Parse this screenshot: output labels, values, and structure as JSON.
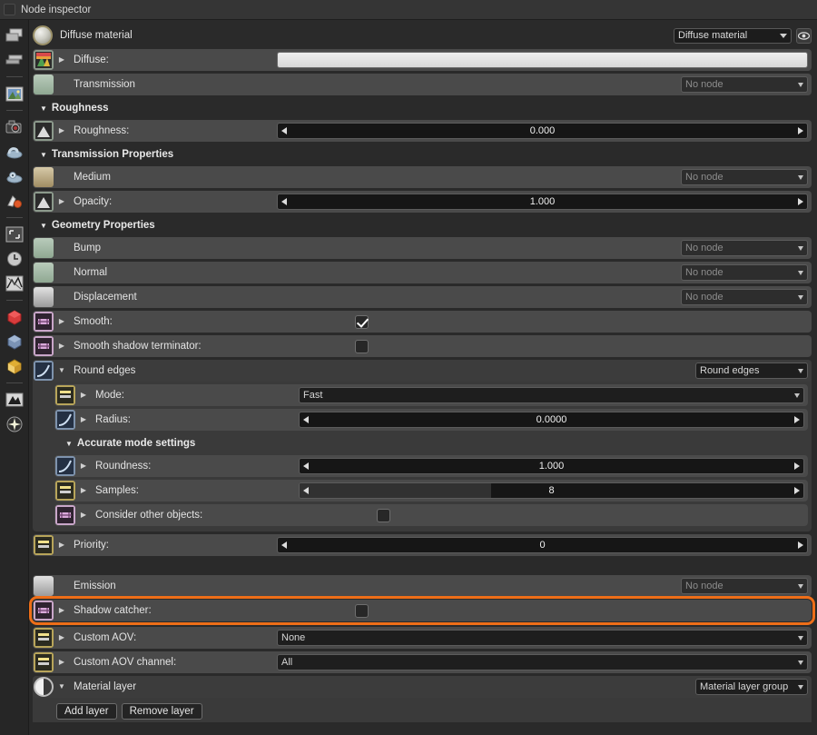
{
  "window": {
    "title": "Node inspector"
  },
  "toolbar": {
    "items": [
      {
        "name": "render-layers-icon",
        "label": "Render layers"
      },
      {
        "name": "layers-stack-icon",
        "label": "Layers"
      },
      {
        "name": "image-icon",
        "label": "Image"
      },
      {
        "name": "camera-icon",
        "label": "Camera"
      },
      {
        "name": "environment-icon",
        "label": "Environment"
      },
      {
        "name": "geometry-icon",
        "label": "Geometry"
      },
      {
        "name": "material-icon",
        "label": "Material"
      },
      {
        "name": "render-region-icon",
        "label": "Render region"
      },
      {
        "name": "clock-icon",
        "label": "Time"
      },
      {
        "name": "noise-icon",
        "label": "Noise"
      },
      {
        "name": "red-cube-icon",
        "label": "Red object"
      },
      {
        "name": "blue-cube-icon",
        "label": "Blue object"
      },
      {
        "name": "yellow-cube-icon",
        "label": "Yellow object"
      },
      {
        "name": "histogram-icon",
        "label": "Imager"
      },
      {
        "name": "star-icon",
        "label": "Kernel"
      }
    ]
  },
  "node_header": {
    "title": "Diffuse material",
    "type_combo": "Diffuse material",
    "eye_icon": "eye-icon"
  },
  "rows": {
    "diffuse": {
      "label": "Diffuse:",
      "value_kind": "color",
      "color": "#e4e4e4"
    },
    "transmission": {
      "label": "Transmission",
      "value": "No node"
    },
    "roughness_section": "Roughness",
    "roughness": {
      "label": "Roughness:",
      "value": "0.000"
    },
    "transmission_section": "Transmission Properties",
    "medium": {
      "label": "Medium",
      "value": "No node"
    },
    "opacity": {
      "label": "Opacity:",
      "value": "1.000"
    },
    "geometry_section": "Geometry Properties",
    "bump": {
      "label": "Bump",
      "value": "No node"
    },
    "normal": {
      "label": "Normal",
      "value": "No node"
    },
    "displacement": {
      "label": "Displacement",
      "value": "No node"
    },
    "smooth": {
      "label": "Smooth:",
      "checked": "true"
    },
    "smooth_shadow": {
      "label": "Smooth shadow terminator:",
      "checked": "false"
    },
    "round_edges": {
      "label": "Round edges",
      "combo": "Round edges"
    },
    "mode": {
      "label": "Mode:",
      "value": "Fast"
    },
    "radius": {
      "label": "Radius:",
      "value": "0.0000"
    },
    "accurate_section": "Accurate mode settings",
    "roundness": {
      "label": "Roundness:",
      "value": "1.000"
    },
    "samples": {
      "label": "Samples:",
      "value": "8",
      "fill_pct": 38
    },
    "consider_other": {
      "label": "Consider other objects:",
      "checked": "false"
    },
    "priority": {
      "label": "Priority:",
      "value": "0"
    },
    "emission": {
      "label": "Emission",
      "value": "No node"
    },
    "shadow_catcher": {
      "label": "Shadow catcher:",
      "checked": "false",
      "highlight": "#ee6e18"
    },
    "custom_aov": {
      "label": "Custom AOV:",
      "value": "None"
    },
    "custom_aov_channel": {
      "label": "Custom AOV channel:",
      "value": "All"
    },
    "material_layer": {
      "label": "Material layer",
      "combo": "Material layer group"
    },
    "add_layer_button": "Add layer",
    "remove_layer_button": "Remove layer"
  }
}
